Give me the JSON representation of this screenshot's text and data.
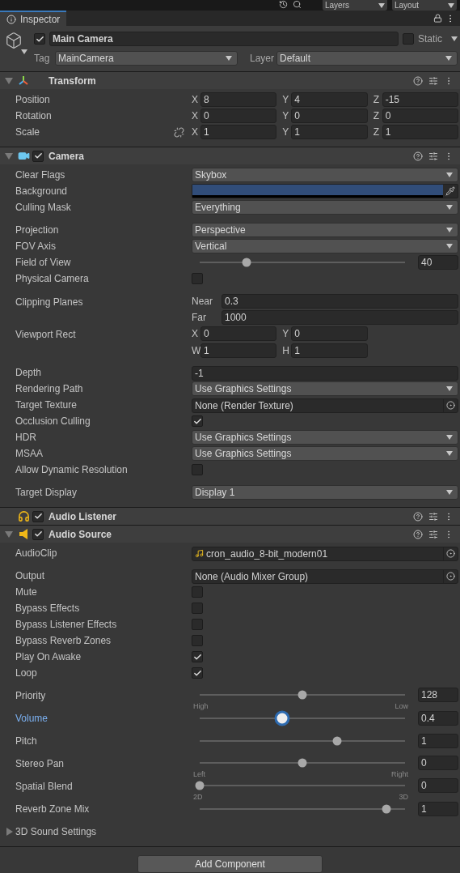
{
  "toolbar": {
    "dropdowns": [
      "Layers",
      "Layout"
    ]
  },
  "tab": {
    "label": "Inspector",
    "selected": true
  },
  "object": {
    "active": true,
    "name": "Main Camera",
    "static": false,
    "static_label": "Static",
    "tag_label": "Tag",
    "tag": "MainCamera",
    "layer_label": "Layer",
    "layer": "Default"
  },
  "components": [
    {
      "kind": "transform",
      "name": "Transform",
      "expanded": true,
      "groups": [
        [
          {
            "kind": "vector",
            "label": "Position",
            "fields": [
              {
                "axis": "X",
                "value": "8"
              },
              {
                "axis": "Y",
                "value": "4"
              },
              {
                "axis": "Z",
                "value": "-15"
              }
            ]
          },
          {
            "kind": "vector",
            "label": "Rotation",
            "fields": [
              {
                "axis": "X",
                "value": "0"
              },
              {
                "axis": "Y",
                "value": "0"
              },
              {
                "axis": "Z",
                "value": "0"
              }
            ]
          },
          {
            "kind": "vector",
            "label": "Scale",
            "constrained": false,
            "fields": [
              {
                "axis": "X",
                "value": "1"
              },
              {
                "axis": "Y",
                "value": "1"
              },
              {
                "axis": "Z",
                "value": "1"
              }
            ]
          }
        ]
      ]
    },
    {
      "kind": "camera",
      "name": "Camera",
      "enabled": true,
      "expanded": true,
      "groups": [
        [
          {
            "kind": "dropdown",
            "label": "Clear Flags",
            "value": "Skybox"
          },
          {
            "kind": "color",
            "label": "Background",
            "color": "#314d79"
          },
          {
            "kind": "dropdown",
            "label": "Culling Mask",
            "value": "Everything"
          }
        ],
        [
          {
            "kind": "dropdown",
            "label": "Projection",
            "value": "Perspective"
          },
          {
            "kind": "dropdown",
            "label": "FOV Axis",
            "value": "Vertical"
          },
          {
            "kind": "slider",
            "label": "Field of View",
            "level": 0.23,
            "value": "40",
            "focused": false
          },
          {
            "kind": "checkbox",
            "label": "Physical Camera",
            "checked": false
          }
        ],
        [
          {
            "kind": "pair",
            "label": "Clipping Planes",
            "fields": [
              {
                "axis": "Near",
                "value": "0.3"
              },
              {
                "axis": "Far",
                "value": "1000"
              }
            ]
          },
          {
            "kind": "rect",
            "label": "Viewport Rect",
            "fields": [
              {
                "axis": "X",
                "value": "0"
              },
              {
                "axis": "Y",
                "value": "0"
              },
              {
                "axis": "W",
                "value": "1"
              },
              {
                "axis": "H",
                "value": "1"
              }
            ]
          }
        ],
        [
          {
            "kind": "text",
            "label": "Depth",
            "value": "-1"
          },
          {
            "kind": "dropdown",
            "label": "Rendering Path",
            "value": "Use Graphics Settings"
          },
          {
            "kind": "object",
            "label": "Target Texture",
            "value": "None (Render Texture)"
          },
          {
            "kind": "checkbox",
            "label": "Occlusion Culling",
            "checked": true
          },
          {
            "kind": "dropdown",
            "label": "HDR",
            "value": "Use Graphics Settings"
          },
          {
            "kind": "dropdown",
            "label": "MSAA",
            "value": "Use Graphics Settings"
          },
          {
            "kind": "checkbox",
            "label": "Allow Dynamic Resolution",
            "checked": false
          }
        ],
        [
          {
            "kind": "dropdown",
            "label": "Target Display",
            "value": "Display 1"
          }
        ]
      ]
    },
    {
      "kind": "listener",
      "name": "Audio Listener",
      "enabled": true
    },
    {
      "kind": "audio",
      "name": "Audio Source",
      "enabled": true,
      "expanded": true,
      "groups": [
        [
          {
            "kind": "clip",
            "label": "AudioClip",
            "value": "cron_audio_8-bit_modern01"
          }
        ],
        [
          {
            "kind": "object",
            "label": "Output",
            "value": "None (Audio Mixer Group)"
          },
          {
            "kind": "checkbox",
            "label": "Mute",
            "checked": false
          },
          {
            "kind": "checkbox",
            "label": "Bypass Effects",
            "checked": false
          },
          {
            "kind": "checkbox",
            "label": "Bypass Listener Effects",
            "checked": false
          },
          {
            "kind": "checkbox",
            "label": "Bypass Reverb Zones",
            "checked": false
          },
          {
            "kind": "checkbox",
            "label": "Play On Awake",
            "checked": true
          },
          {
            "kind": "checkbox",
            "label": "Loop",
            "checked": true
          }
        ],
        [
          {
            "kind": "slider",
            "label": "Priority",
            "level": 0.5,
            "value": "128",
            "focused": false,
            "min_label": "High",
            "max_label": "Low"
          },
          {
            "kind": "slider",
            "label": "Volume",
            "level": 0.4,
            "value": "0.4",
            "focused": true
          }
        ],
        [
          {
            "kind": "slider",
            "label": "Pitch",
            "level": 0.67,
            "value": "1",
            "focused": false
          }
        ],
        [
          {
            "kind": "slider",
            "label": "Stereo Pan",
            "level": 0.5,
            "value": "0",
            "focused": false,
            "min_label": "Left",
            "max_label": "Right"
          },
          {
            "kind": "slider",
            "label": "Spatial Blend",
            "level": 0,
            "value": "0",
            "focused": false,
            "min_label": "2D",
            "max_label": "3D"
          },
          {
            "kind": "slider",
            "label": "Reverb Zone Mix",
            "level": 0.91,
            "value": "1",
            "focused": false
          }
        ],
        [
          {
            "kind": "foldout",
            "label": "3D Sound Settings",
            "expanded": false
          }
        ]
      ]
    }
  ],
  "add_component": "Add Component"
}
